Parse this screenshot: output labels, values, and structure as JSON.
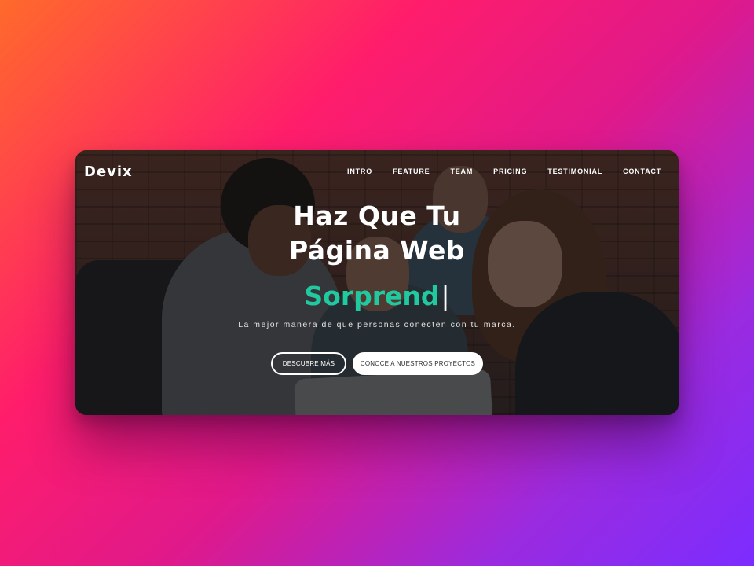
{
  "brand": {
    "logo": "Devix"
  },
  "nav": {
    "items": [
      {
        "label": "INTRO"
      },
      {
        "label": "FEATURE"
      },
      {
        "label": "TEAM"
      },
      {
        "label": "PRICING"
      },
      {
        "label": "TESTIMONIAL"
      },
      {
        "label": "CONTACT"
      }
    ]
  },
  "hero": {
    "headline_line1": "Haz Que Tu",
    "headline_line2": "Página Web",
    "typed_text": "Sorprend",
    "cursor": "|",
    "tagline": "La mejor manera de que personas conecten con tu marca.",
    "primary_button": "DESCUBRE MÁS",
    "secondary_button": "CONOCE A NUESTROS PROYECTOS"
  },
  "colors": {
    "accent": "#21c9a0",
    "text": "#ffffff",
    "overlay": "#121214"
  }
}
